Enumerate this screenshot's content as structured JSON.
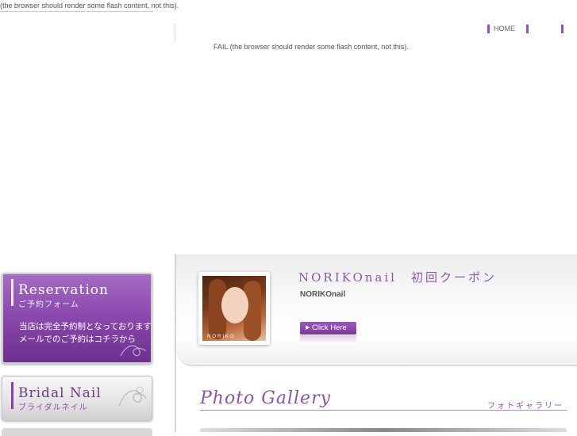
{
  "flash_fallback": {
    "header_text": "(the browser should render some flash content, not this).",
    "center_text": "FAIL (the browser should render some flash content, not this)."
  },
  "topnav": {
    "items": [
      {
        "label": "HOME"
      },
      {
        "label": ""
      },
      {
        "label": ""
      }
    ],
    "accent_color": "#9b4dbd"
  },
  "sidebar": {
    "reservation": {
      "title": "Reservation",
      "subtitle": "ご予約フォーム",
      "line1": "当店は完全予約制となっております",
      "line2": "メールでのご予約はコチラから"
    },
    "bridal": {
      "title": "Bridal Nail",
      "subtitle": "ブライダルネイル"
    }
  },
  "coupon": {
    "title": "NORIKOnail　初回クーポン",
    "name": "NORIKOnail",
    "photo_caption": "NORIKO",
    "button_label": "Click Here"
  },
  "gallery": {
    "title": "Photo Gallery",
    "subtitle": "フォトギャラリー"
  },
  "colors": {
    "brand_purple": "#8a4aaf",
    "text_gray": "#555555"
  }
}
